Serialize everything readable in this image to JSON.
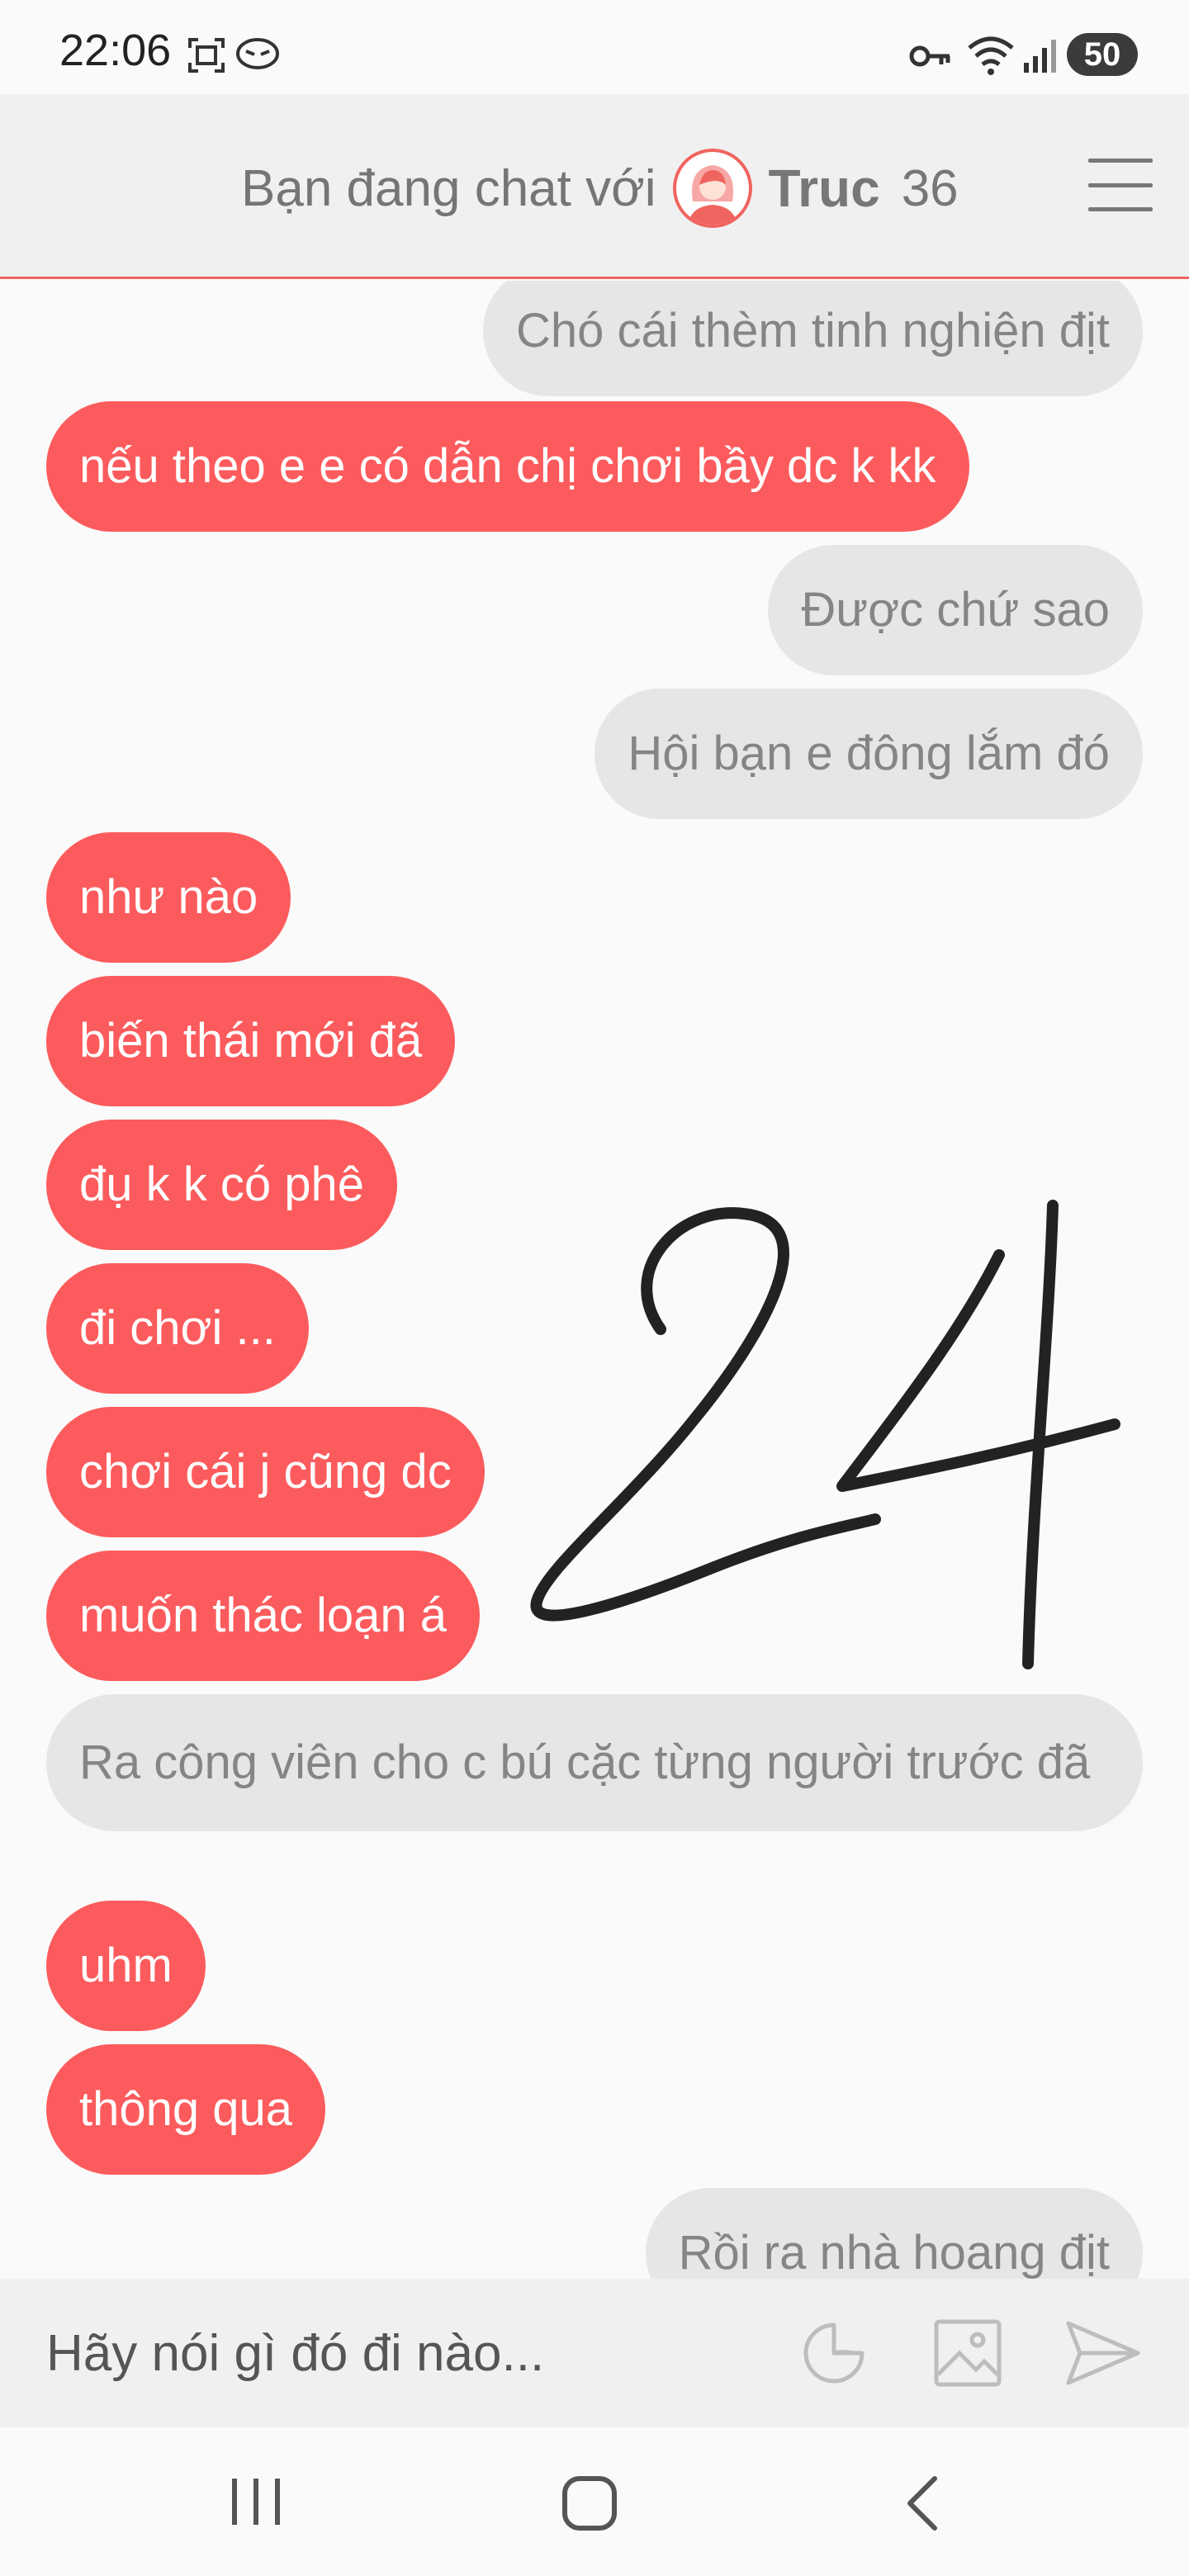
{
  "status_bar": {
    "time": "22:06",
    "battery": "50",
    "icons": [
      "screenshot-icon",
      "chat-bubble-icon",
      "key-icon",
      "wifi-icon",
      "signal-icon"
    ]
  },
  "header": {
    "chat_with_label": "Bạn đang chat với",
    "partner_name": "Truc",
    "partner_age": "36",
    "avatar_icon": "avatar-female-icon",
    "menu_icon": "hamburger-menu-icon",
    "accent_color": "#f0645f"
  },
  "messages": [
    {
      "side": "recv",
      "text": "Chó cái thèm tinh nghiện địt"
    },
    {
      "side": "sent",
      "text": "nếu theo e e có dẫn chị chơi bầy dc k kk"
    },
    {
      "side": "recv",
      "text": "Được chứ sao"
    },
    {
      "side": "recv",
      "text": "Hội bạn e đông lắm đó"
    },
    {
      "side": "sent",
      "text": "như nào"
    },
    {
      "side": "sent",
      "text": "biến thái mới đã"
    },
    {
      "side": "sent",
      "text": "đụ k k có phê"
    },
    {
      "side": "sent",
      "text": "đi chơi ..."
    },
    {
      "side": "sent",
      "text": "chơi cái j cũng dc"
    },
    {
      "side": "sent",
      "text": "muốn thác loạn á"
    },
    {
      "side": "recv",
      "text": "Ra công viên cho c bú cặc từng người trước đã"
    },
    {
      "side": "sent",
      "text": "uhm"
    },
    {
      "side": "sent",
      "text": "thông qua"
    },
    {
      "side": "recv",
      "text": "Rồi ra nhà hoang địt"
    }
  ],
  "handwritten_overlay": "24",
  "input_bar": {
    "placeholder": "Hãy nói gì đó đi nào...",
    "icons": [
      "sticker-icon",
      "image-icon",
      "send-icon"
    ]
  },
  "nav_bar": {
    "icons": [
      "recent-apps-icon",
      "home-icon",
      "back-icon"
    ]
  },
  "colors": {
    "sent_bubble": "#fc5b5d",
    "recv_bubble": "#e6e6e6",
    "recv_text": "#858585"
  }
}
